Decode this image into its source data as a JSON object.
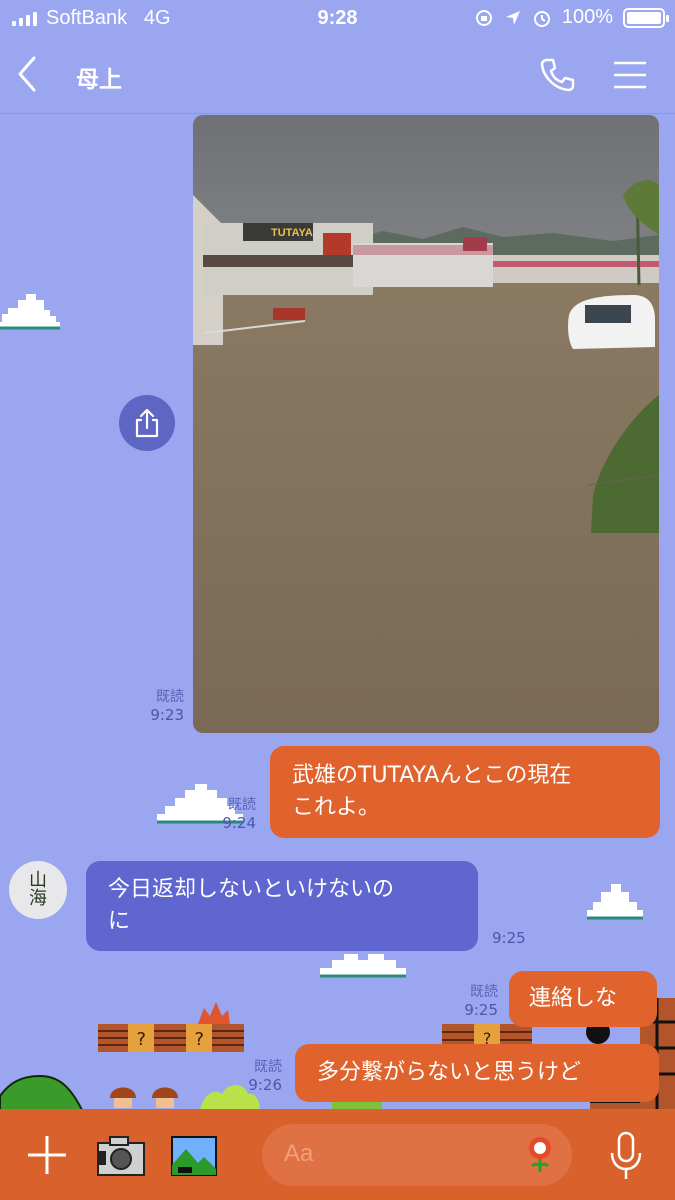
{
  "status_bar": {
    "carrier": "SoftBank",
    "network": "4G",
    "time": "9:28",
    "battery": "100%"
  },
  "header": {
    "title": "母上"
  },
  "messages": [
    {
      "type": "image",
      "direction": "out",
      "read": "既読",
      "time": "9:23"
    },
    {
      "type": "text",
      "direction": "out",
      "line1": "武雄のTUTAYAんとこの現在",
      "line2": "これよ。",
      "read": "既読",
      "time": "9:24"
    },
    {
      "type": "text",
      "direction": "in",
      "line1": "今日返却しないといけないの",
      "line2": "に",
      "time": "9:25"
    },
    {
      "type": "text",
      "direction": "out",
      "line1": "連絡しな",
      "read": "既読",
      "time": "9:25"
    },
    {
      "type": "text",
      "direction": "out",
      "line1": "多分繋がらないと思うけど",
      "read": "既読",
      "time": "9:26"
    }
  ],
  "photo": {
    "store_sign": "TUTAYA"
  },
  "avatar": {
    "char1": "山",
    "char2": "海"
  },
  "input": {
    "placeholder": "Aa"
  },
  "colors": {
    "background": "#9aa6f0",
    "outgoing_bubble": "#e0622d",
    "incoming_bubble": "#5f66d0",
    "bottom_bar": "#d9622c"
  }
}
